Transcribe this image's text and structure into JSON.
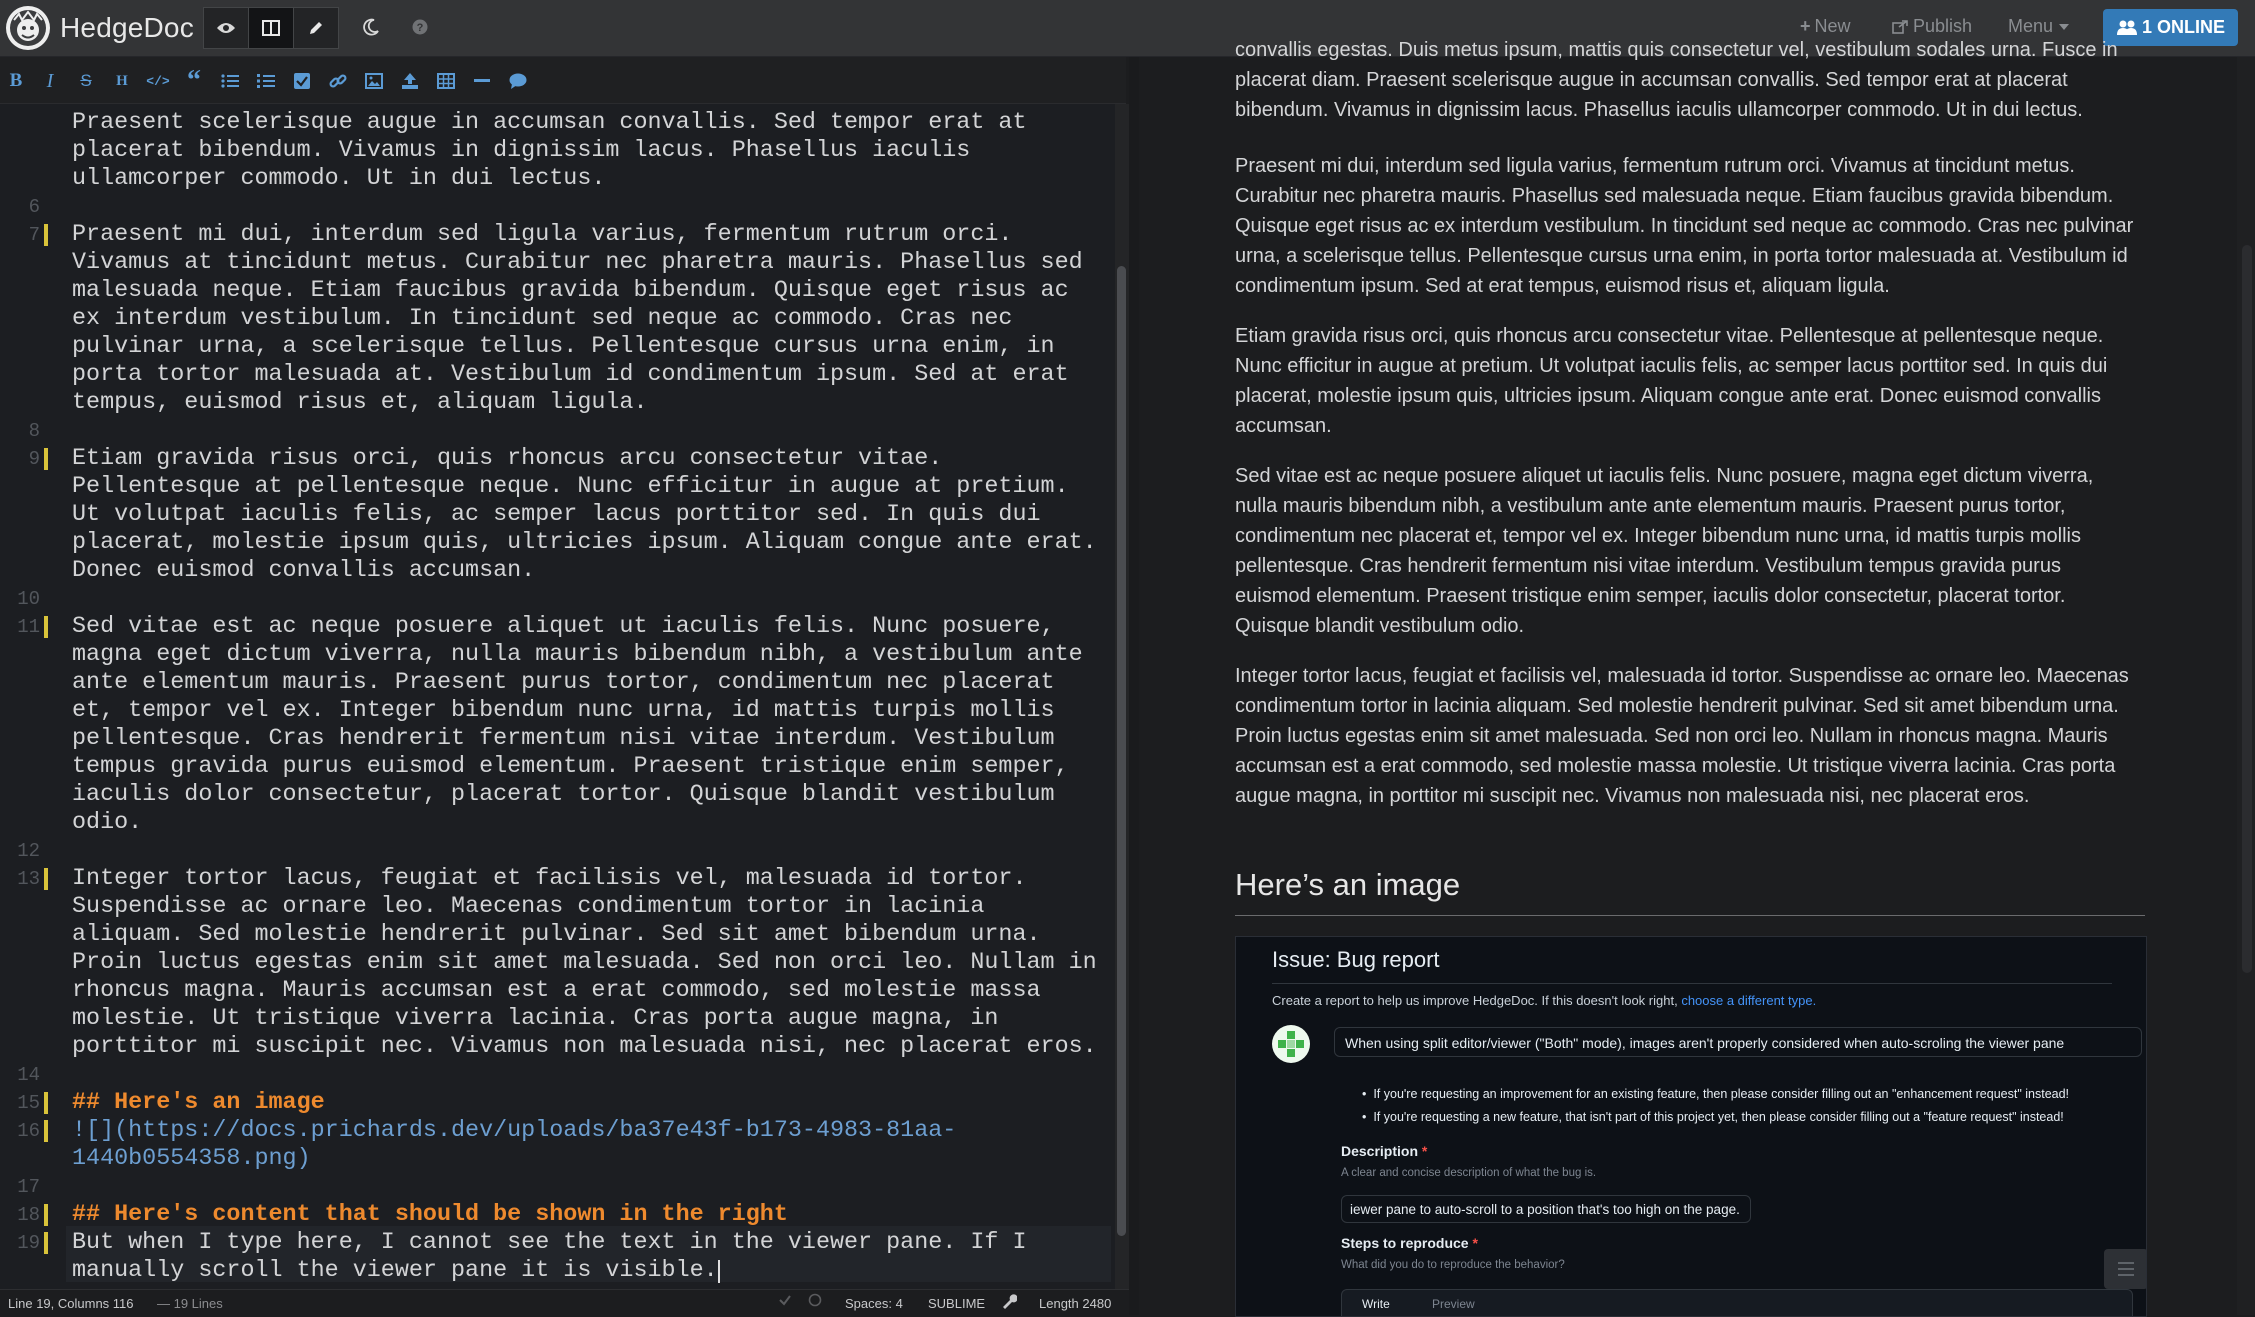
{
  "app": {
    "name": "HedgeDoc",
    "colors": {
      "accent": "#337ab7",
      "heading": "#ee8a2e",
      "link": "#6d9fd1",
      "editor_bg": "#1c1e22",
      "viewer_bg": "#1c1d1f"
    }
  },
  "navbar": {
    "modes": [
      {
        "name": "view",
        "icon": "eye-icon"
      },
      {
        "name": "both",
        "icon": "columns-icon",
        "active": true
      },
      {
        "name": "edit",
        "icon": "pencil-icon"
      }
    ],
    "night_icon": "moon-icon",
    "help_icon": "question-circle-icon",
    "new_label": "New",
    "publish_label": "Publish",
    "menu_label": "Menu",
    "online_label": "1 ONLINE"
  },
  "toolbar": {
    "buttons": [
      "bold",
      "italic",
      "strikethrough",
      "heading",
      "code",
      "quote",
      "unordered-list",
      "ordered-list",
      "checklist",
      "link",
      "image",
      "upload",
      "table",
      "horizontal-rule",
      "comment"
    ]
  },
  "editor": {
    "lines": [
      {
        "y": 0,
        "num": "",
        "text": "Praesent scelerisque augue in accumsan convallis. Sed tempor erat at",
        "type": "text"
      },
      {
        "y": 1,
        "num": "",
        "text": "placerat bibendum. Vivamus in dignissim lacus. Phasellus iaculis",
        "type": "text"
      },
      {
        "y": 2,
        "num": "",
        "text": "ullamcorper commodo. Ut in dui lectus.",
        "type": "text"
      },
      {
        "y": 3,
        "num": "6",
        "text": "",
        "type": "text"
      },
      {
        "y": 4,
        "num": "7",
        "text": "Praesent mi dui, interdum sed ligula varius, fermentum rutrum orci.",
        "type": "text",
        "mark": true
      },
      {
        "y": 5,
        "num": "",
        "text": "Vivamus at tincidunt metus. Curabitur nec pharetra mauris. Phasellus sed",
        "type": "text"
      },
      {
        "y": 6,
        "num": "",
        "text": "malesuada neque. Etiam faucibus gravida bibendum. Quisque eget risus ac",
        "type": "text"
      },
      {
        "y": 7,
        "num": "",
        "text": "ex interdum vestibulum. In tincidunt sed neque ac commodo. Cras nec",
        "type": "text"
      },
      {
        "y": 8,
        "num": "",
        "text": "pulvinar urna, a scelerisque tellus. Pellentesque cursus urna enim, in",
        "type": "text"
      },
      {
        "y": 9,
        "num": "",
        "text": "porta tortor malesuada at. Vestibulum id condimentum ipsum. Sed at erat",
        "type": "text"
      },
      {
        "y": 10,
        "num": "",
        "text": "tempus, euismod risus et, aliquam ligula.",
        "type": "text"
      },
      {
        "y": 11,
        "num": "8",
        "text": "",
        "type": "text"
      },
      {
        "y": 12,
        "num": "9",
        "text": "Etiam gravida risus orci, quis rhoncus arcu consectetur vitae.",
        "type": "text",
        "mark": true
      },
      {
        "y": 13,
        "num": "",
        "text": "Pellentesque at pellentesque neque. Nunc efficitur in augue at pretium.",
        "type": "text"
      },
      {
        "y": 14,
        "num": "",
        "text": "Ut volutpat iaculis felis, ac semper lacus porttitor sed. In quis dui",
        "type": "text"
      },
      {
        "y": 15,
        "num": "",
        "text": "placerat, molestie ipsum quis, ultricies ipsum. Aliquam congue ante erat.",
        "type": "text"
      },
      {
        "y": 16,
        "num": "",
        "text": "Donec euismod convallis accumsan.",
        "type": "text"
      },
      {
        "y": 17,
        "num": "10",
        "text": "",
        "type": "text"
      },
      {
        "y": 18,
        "num": "11",
        "text": "Sed vitae est ac neque posuere aliquet ut iaculis felis. Nunc posuere,",
        "type": "text",
        "mark": true
      },
      {
        "y": 19,
        "num": "",
        "text": "magna eget dictum viverra, nulla mauris bibendum nibh, a vestibulum ante",
        "type": "text"
      },
      {
        "y": 20,
        "num": "",
        "text": "ante elementum mauris. Praesent purus tortor, condimentum nec placerat",
        "type": "text"
      },
      {
        "y": 21,
        "num": "",
        "text": "et, tempor vel ex. Integer bibendum nunc urna, id mattis turpis mollis",
        "type": "text"
      },
      {
        "y": 22,
        "num": "",
        "text": "pellentesque. Cras hendrerit fermentum nisi vitae interdum. Vestibulum",
        "type": "text"
      },
      {
        "y": 23,
        "num": "",
        "text": "tempus gravida purus euismod elementum. Praesent tristique enim semper,",
        "type": "text"
      },
      {
        "y": 24,
        "num": "",
        "text": "iaculis dolor consectetur, placerat tortor. Quisque blandit vestibulum",
        "type": "text"
      },
      {
        "y": 25,
        "num": "",
        "text": "odio.",
        "type": "text"
      },
      {
        "y": 26,
        "num": "12",
        "text": "",
        "type": "text"
      },
      {
        "y": 27,
        "num": "13",
        "text": "Integer tortor lacus, feugiat et facilisis vel, malesuada id tortor.",
        "type": "text",
        "mark": true
      },
      {
        "y": 28,
        "num": "",
        "text": "Suspendisse ac ornare leo. Maecenas condimentum tortor in lacinia",
        "type": "text"
      },
      {
        "y": 29,
        "num": "",
        "text": "aliquam. Sed molestie hendrerit pulvinar. Sed sit amet bibendum urna.",
        "type": "text"
      },
      {
        "y": 30,
        "num": "",
        "text": "Proin luctus egestas enim sit amet malesuada. Sed non orci leo. Nullam in",
        "type": "text"
      },
      {
        "y": 31,
        "num": "",
        "text": "rhoncus magna. Mauris accumsan est a erat commodo, sed molestie massa",
        "type": "text"
      },
      {
        "y": 32,
        "num": "",
        "text": "molestie. Ut tristique viverra lacinia. Cras porta augue magna, in",
        "type": "text"
      },
      {
        "y": 33,
        "num": "",
        "text": "porttitor mi suscipit nec. Vivamus non malesuada nisi, nec placerat eros.",
        "type": "text"
      },
      {
        "y": 34,
        "num": "14",
        "text": "",
        "type": "text"
      },
      {
        "y": 35,
        "num": "15",
        "text": "## Here's an image",
        "type": "heading",
        "mark": true
      },
      {
        "y": 36,
        "num": "16",
        "text": "![](https://docs.prichards.dev/uploads/ba37e43f-b173-4983-81aa-",
        "type": "url",
        "mark": true
      },
      {
        "y": 37,
        "num": "",
        "text": "1440b0554358.png)",
        "type": "url"
      },
      {
        "y": 38,
        "num": "17",
        "text": "",
        "type": "text"
      },
      {
        "y": 39,
        "num": "18",
        "text": "## Here's content that should be shown in the right",
        "type": "heading",
        "mark": true
      },
      {
        "y": 40,
        "num": "19",
        "text": "But when I type here, I cannot see the text in the viewer pane. If I",
        "type": "text",
        "mark": true
      },
      {
        "y": 41,
        "num": "",
        "text": "manually scroll the viewer pane it is visible.",
        "type": "text",
        "cursor": true
      }
    ]
  },
  "statusbar": {
    "position": "Line 19, Columns 116",
    "lines": "— 19 Lines",
    "spaces": "Spaces: 4",
    "keymap": "SUBLIME",
    "length": "Length 2480"
  },
  "viewer": {
    "paragraphs": [
      "convallis egestas. Duis metus ipsum, mattis quis consectetur vel, vestibulum sodales urna. Fusce in placerat diam. Praesent scelerisque augue in accumsan convallis. Sed tempor erat at placerat bibendum. Vivamus in dignissim lacus. Phasellus iaculis ullamcorper commodo. Ut in dui lectus.",
      "Praesent mi dui, interdum sed ligula varius, fermentum rutrum orci. Vivamus at tincidunt metus. Curabitur nec pharetra mauris. Phasellus sed malesuada neque. Etiam faucibus gravida bibendum. Quisque eget risus ac ex interdum vestibulum. In tincidunt sed neque ac commodo. Cras nec pulvinar urna, a scelerisque tellus. Pellentesque cursus urna enim, in porta tortor malesuada at. Vestibulum id condimentum ipsum. Sed at erat tempus, euismod risus et, aliquam ligula.",
      "Etiam gravida risus orci, quis rhoncus arcu consectetur vitae. Pellentesque at pellentesque neque. Nunc efficitur in augue at pretium. Ut volutpat iaculis felis, ac semper lacus porttitor sed. In quis dui placerat, molestie ipsum quis, ultricies ipsum. Aliquam congue ante erat. Donec euismod convallis accumsan.",
      "Sed vitae est ac neque posuere aliquet ut iaculis felis. Nunc posuere, magna eget dictum viverra, nulla mauris bibendum nibh, a vestibulum ante ante elementum mauris. Praesent purus tortor, condimentum nec placerat et, tempor vel ex. Integer bibendum nunc urna, id mattis turpis mollis pellentesque. Cras hendrerit fermentum nisi vitae interdum. Vestibulum tempus gravida purus euismod elementum. Praesent tristique enim semper, iaculis dolor consectetur, placerat tortor. Quisque blandit vestibulum odio.",
      "Integer tortor lacus, feugiat et facilisis vel, malesuada id tortor. Suspendisse ac ornare leo. Maecenas condimentum tortor in lacinia aliquam. Sed molestie hendrerit pulvinar. Sed sit amet bibendum urna. Proin luctus egestas enim sit amet malesuada. Sed non orci leo. Nullam in rhoncus magna. Mauris accumsan est a erat commodo, sed molestie massa molestie. Ut tristique viverra lacinia. Cras porta augue magna, in porttitor mi suscipit nec. Vivamus non malesuada nisi, nec placerat eros."
    ],
    "heading": "Here’s an image",
    "embedded": {
      "title": "Issue: Bug report",
      "desc_prefix": "Create a report to help us improve HedgeDoc. If this doesn't look right, ",
      "desc_link": "choose a different type.",
      "issue_title": "When using split editor/viewer (\"Both\" mode), images aren't properly considered when auto-scroling the viewer pane",
      "bullets": [
        "If you're requesting an improvement for an existing feature, then please consider filling out an \"enhancement request\" instead!",
        "If you're requesting a new feature, that isn't part of this project yet, then please consider filling out a \"feature request\" instead!"
      ],
      "description_label": "Description",
      "description_hint": "A clear and concise description of what the bug is.",
      "description_value": "iewer pane to auto-scroll to a position that's too high on the page.",
      "steps_label": "Steps to reproduce",
      "steps_hint": "What did you do to reproduce the behavior?",
      "tab_write": "Write",
      "tab_preview": "Preview"
    }
  }
}
